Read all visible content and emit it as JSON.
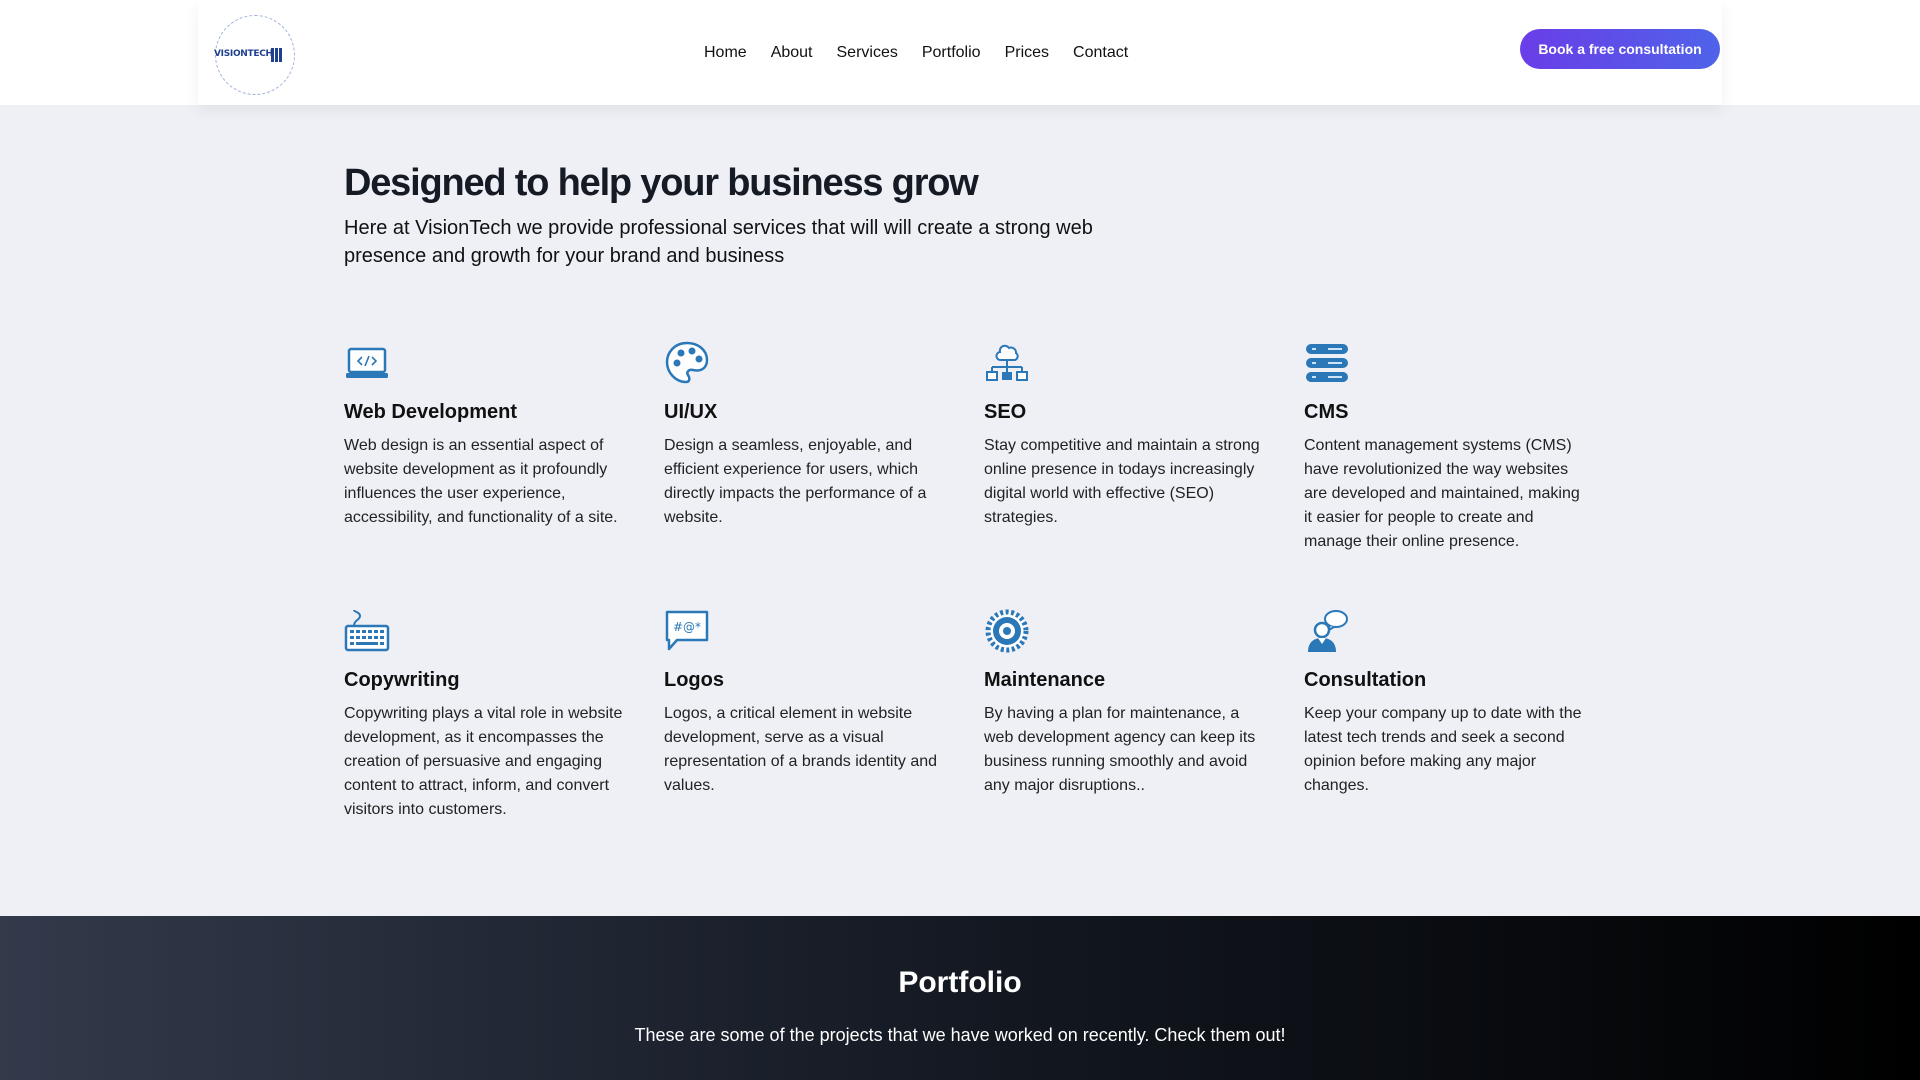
{
  "header": {
    "logo_text": "VISIONTECH",
    "nav": [
      "Home",
      "About",
      "Services",
      "Portfolio",
      "Prices",
      "Contact"
    ],
    "cta_label": "Book a free consultation"
  },
  "services": {
    "title": "Designed to help your business grow",
    "intro": "Here at VisionTech we provide professional services that will will create a strong web presence and growth for your brand and business",
    "items": [
      {
        "icon": "laptop-code-icon",
        "title": "Web Development",
        "text": "Web design is an essential aspect of website development as it profoundly influences the user experience, accessibility, and functionality of a site."
      },
      {
        "icon": "palette-icon",
        "title": "UI/UX",
        "text": "Design a seamless, enjoyable, and efficient experience for users, which directly impacts the performance of a website."
      },
      {
        "icon": "network-icon",
        "title": "SEO",
        "text": "Stay competitive and maintain a strong online presence in todays increasingly digital world with effective (SEO) strategies."
      },
      {
        "icon": "database-icon",
        "title": "CMS",
        "text": "Content management systems (CMS) have revolutionized the way websites are developed and maintained, making it easier for people to create and manage their online presence."
      },
      {
        "icon": "keyboard-icon",
        "title": "Copywriting",
        "text": "Copywriting plays a vital role in website development, as it encompasses the creation of persuasive and engaging content to attract, inform, and convert visitors into customers."
      },
      {
        "icon": "speech-bubble-icon",
        "title": "Logos",
        "text": "Logos, a critical element in website development, serve as a visual representation of a brands identity and values."
      },
      {
        "icon": "gear-icon",
        "title": "Maintenance",
        "text": "By having a plan for maintenance, a web development agency can keep its business running smoothly and avoid any major disruptions.."
      },
      {
        "icon": "consultant-icon",
        "title": "Consultation",
        "text": "Keep your company up to date with the latest tech trends and seek a second opinion before making any major changes."
      }
    ]
  },
  "portfolio": {
    "title": "Portfolio",
    "text": "These are some of the projects that we have worked on recently. Check them out!"
  },
  "colors": {
    "accent": "#2a78b8",
    "cta_start": "#6a3de8",
    "cta_end": "#4f63e9"
  }
}
